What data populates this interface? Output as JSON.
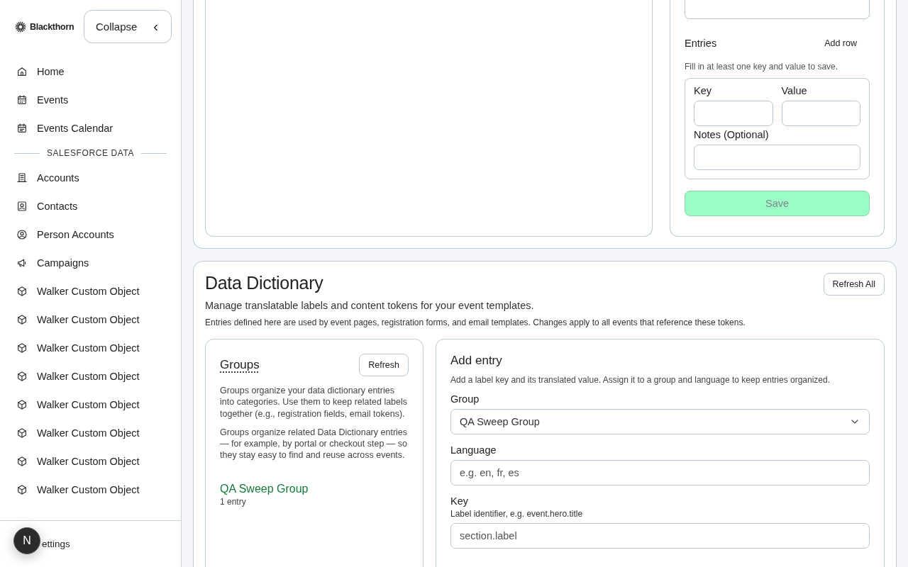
{
  "sidebar": {
    "brand": "Blackthorn",
    "collapse_button": "Collapse",
    "collapse_caret": "‹",
    "nav": [
      {
        "label": "Home"
      },
      {
        "label": "Events"
      },
      {
        "label": "Events Calendar"
      }
    ],
    "section_heading": "SALESFORCE DATA",
    "data_items": [
      {
        "label": "Accounts"
      },
      {
        "label": "Contacts"
      },
      {
        "label": "Person Accounts"
      },
      {
        "label": "Campaigns"
      },
      {
        "label": "Walker Custom Object"
      },
      {
        "label": "Walker Custom Object"
      },
      {
        "label": "Walker Custom Object"
      },
      {
        "label": "Walker Custom Object"
      },
      {
        "label": "Walker Custom Object"
      },
      {
        "label": "Walker Custom Object"
      },
      {
        "label": "Walker Custom Object"
      },
      {
        "label": "Walker Custom Object"
      }
    ],
    "footer_item": "ettings",
    "avatar": "N"
  },
  "top_card": {
    "entries": {
      "title": "Entries",
      "add_row": "Add row",
      "hint": "Fill in at least one key and value to save.",
      "fields": [
        {
          "label": "Key"
        },
        {
          "label": "Value"
        },
        {
          "label": "Notes (Optional)"
        }
      ],
      "save_button": {
        "label": "Save",
        "disabled": true
      }
    }
  },
  "data_dictionary": {
    "title": "Data Dictionary",
    "refresh_all": "Refresh All",
    "subtitle": "Manage translatable labels and content tokens for your event templates.",
    "note": "Entries defined here are used by event pages, registration forms, and email templates. Changes apply to all events that reference these tokens.",
    "groups": {
      "title": "Groups",
      "refresh": "Refresh",
      "descriptions": [
        "Groups organize your data dictionary entries into categories. Use them to keep related labels together (e.g., registration fields, email tokens).",
        "Groups organize related Data Dictionary entries — for example, by portal or checkout step — so they stay easy to find and reuse across events."
      ],
      "items": [
        {
          "name": "QA Sweep Group",
          "count": "1 entry"
        }
      ]
    },
    "add_entry": {
      "title": "Add entry",
      "hint": "Add a label key and its translated value. Assign it to a group and language to keep entries organized.",
      "fields": [
        {
          "kind": "select",
          "label": "Group",
          "value": "QA Sweep Group"
        },
        {
          "kind": "text",
          "label": "Language",
          "placeholder": "e.g. en, fr, es"
        },
        {
          "kind": "text",
          "label": "Key",
          "help": "Label identifier, e.g. event.hero.title",
          "placeholder": "section.label"
        }
      ]
    }
  }
}
